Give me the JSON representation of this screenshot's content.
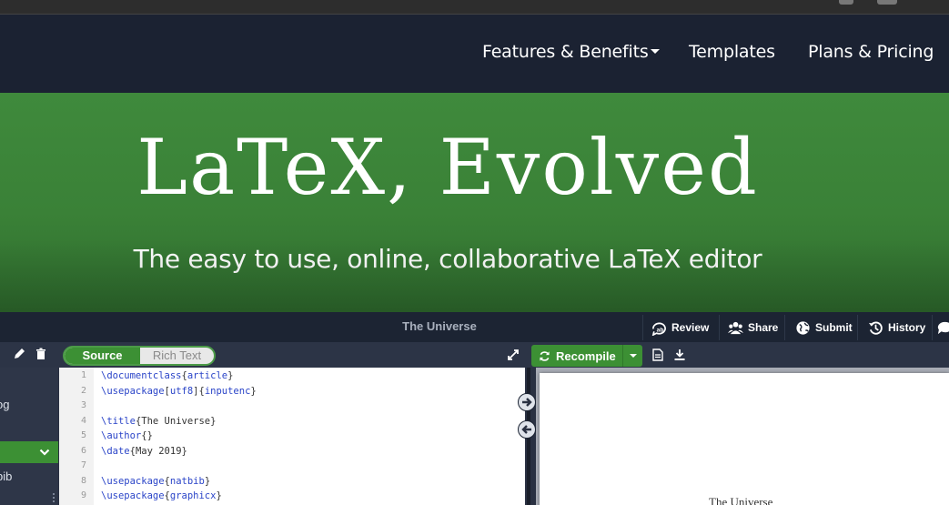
{
  "nav": {
    "items": [
      {
        "label": "Features & Benefits",
        "has_dropdown": true
      },
      {
        "label": "Templates"
      },
      {
        "label": "Plans & Pricing"
      }
    ]
  },
  "hero": {
    "title": "LaTeX, Evolved",
    "subtitle": "The easy to use, online, collaborative LaTeX editor"
  },
  "editor_app": {
    "project_title": "The Universe",
    "toolbar": {
      "review": "Review",
      "share": "Share",
      "submit": "Submit",
      "history": "History"
    },
    "mode_toggle": {
      "source": "Source",
      "rich_text": "Rich Text",
      "selected": "Source"
    },
    "recompile": "Recompile",
    "file_tree": [
      {
        "label": "og",
        "active": false
      },
      {
        "label": "",
        "active": true
      },
      {
        "label": "bib",
        "active": false
      }
    ],
    "code_lines": [
      {
        "n": "1",
        "cmd": "\\documentclass",
        "arg": "{article}"
      },
      {
        "n": "2",
        "cmd": "\\usepackage",
        "arg": "[utf8]{inputenc}"
      },
      {
        "n": "3",
        "cmd": "",
        "arg": ""
      },
      {
        "n": "4",
        "cmd": "\\title",
        "arg": "{The Universe}"
      },
      {
        "n": "5",
        "cmd": "\\author",
        "arg": "{}"
      },
      {
        "n": "6",
        "cmd": "\\date",
        "arg": "{May 2019}"
      },
      {
        "n": "7",
        "cmd": "",
        "arg": ""
      },
      {
        "n": "8",
        "cmd": "\\usepackage",
        "arg": "{natbib}"
      },
      {
        "n": "9",
        "cmd": "\\usepackage",
        "arg": "{graphicx}"
      }
    ],
    "preview_title": "The Universe"
  },
  "colors": {
    "nav_bg": "#1b2232",
    "hero_green": "#3f8a3c",
    "accent_green": "#3c9034",
    "latex_command": "#2a44c8"
  },
  "icons": {
    "review": "review-icon",
    "share": "share-icon",
    "submit": "globe-icon",
    "history": "history-icon",
    "comment": "comment-icon",
    "edit": "pencil-icon",
    "delete": "trash-icon",
    "expand": "expand-icon",
    "recompile": "refresh-icon",
    "log": "document-icon",
    "download": "download-icon"
  }
}
